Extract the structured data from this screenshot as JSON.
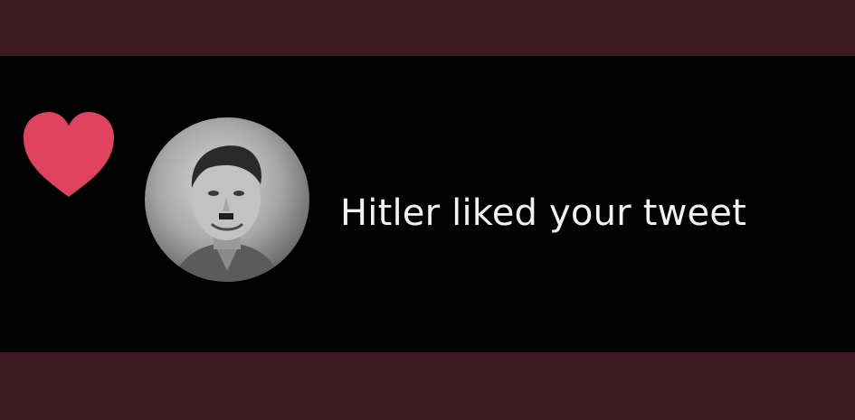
{
  "notification": {
    "type": "like",
    "icon": "heart-icon",
    "icon_color": "#e0435e",
    "avatar": "user-avatar",
    "message": "Hitler liked your tweet"
  },
  "colors": {
    "band": "#3b1a22",
    "card_background": "#020202",
    "text": "#f2f2f2"
  }
}
